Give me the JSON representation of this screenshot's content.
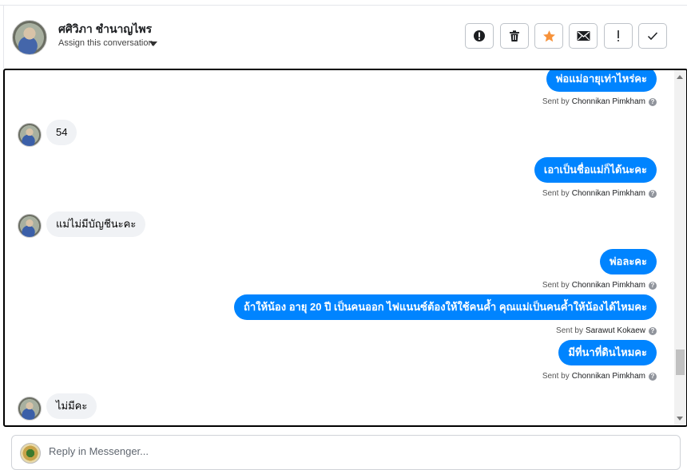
{
  "header": {
    "contact_name": "ศศิวิภา ชำนาญไพร",
    "assign_label": "Assign this conversation",
    "toolbar": [
      {
        "icon": "alert-circle-icon",
        "glyph": "!"
      },
      {
        "icon": "trash-icon",
        "glyph": ""
      },
      {
        "icon": "star-icon",
        "glyph": "★"
      },
      {
        "icon": "envelope-icon",
        "glyph": "✉"
      },
      {
        "icon": "exclamation-icon",
        "glyph": "!"
      },
      {
        "icon": "checkmark-icon",
        "glyph": "✓"
      }
    ]
  },
  "messages": [
    {
      "dir": "out",
      "text": "พ่อแม่อายุเท่าไหร่คะ",
      "sent_by_label": "Sent by",
      "sender": "Chonnikan Pimkham"
    },
    {
      "dir": "in",
      "text": "54"
    },
    {
      "dir": "out",
      "text": "เอาเป็นชื่อแม่ก็ได้นะคะ",
      "sent_by_label": "Sent by",
      "sender": "Chonnikan Pimkham"
    },
    {
      "dir": "in",
      "text": "แม่ไม่มีบัญชีนะคะ"
    },
    {
      "dir": "out",
      "text": "พ่อละคะ",
      "sent_by_label": "Sent by",
      "sender": "Chonnikan Pimkham"
    },
    {
      "dir": "out",
      "text": "ถ้าให้น้อง อายุ 20 ปี เป็นคนออก ไฟแนนซ์ต้องให้ใช้คนค้ำ คุณแม่เป็นคนค้ำให้น้องได้ไหมคะ",
      "sent_by_label": "Sent by",
      "sender": "Sarawut Kokaew"
    },
    {
      "dir": "out",
      "text": "มีที่นาที่ดินไหมคะ",
      "sent_by_label": "Sent by",
      "sender": "Chonnikan Pimkham"
    },
    {
      "dir": "in",
      "text": "ไม่มีคะ"
    }
  ],
  "reply": {
    "placeholder": "Reply in Messenger..."
  },
  "colors": {
    "outgoing_bubble": "#0084ff",
    "incoming_bubble": "#f0f2f5",
    "star": "#f7923a"
  }
}
